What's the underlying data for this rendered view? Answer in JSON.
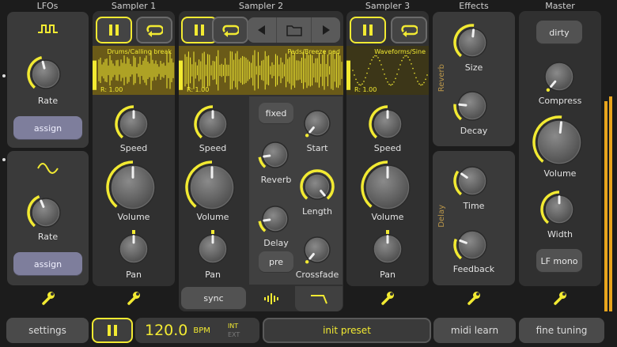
{
  "headers": {
    "lfos": "LFOs",
    "sampler1": "Sampler 1",
    "sampler2": "Sampler 2",
    "sampler3": "Sampler 3",
    "effects": "Effects",
    "master": "Master"
  },
  "lfo1": {
    "knob_label": "Rate",
    "assign_label": "assign",
    "icon": "square-wave-icon"
  },
  "lfo2": {
    "knob_label": "Rate",
    "assign_label": "assign",
    "icon": "sine-wave-icon"
  },
  "sampler1": {
    "sample": "Drums/Calling break",
    "rate": "R: 1.00",
    "speed": "Speed",
    "volume": "Volume",
    "pan": "Pan"
  },
  "sampler2": {
    "sample": "Pads/Breeze pad",
    "rate": "R: 1.00",
    "speed": "Speed",
    "volume": "Volume",
    "pan": "Pan",
    "sync_label": "sync"
  },
  "sampler_settings": {
    "fixed_label": "fixed",
    "pre_label": "pre",
    "reverb": "Reverb",
    "delay": "Delay",
    "start": "Start",
    "length": "Length",
    "crossfade": "Crossfade"
  },
  "sampler3": {
    "sample": "Waveforms/Sine",
    "rate": "R: 1.00",
    "speed": "Speed",
    "volume": "Volume",
    "pan": "Pan"
  },
  "effects": {
    "reverb_group": "Reverb",
    "delay_group": "Delay",
    "size": "Size",
    "decay": "Decay",
    "time": "Time",
    "feedback": "Feedback"
  },
  "master": {
    "dirty_label": "dirty",
    "compress": "Compress",
    "volume": "Volume",
    "width": "Width",
    "lf_mono_label": "LF mono"
  },
  "bottom": {
    "settings_label": "settings",
    "bpm_value": "120.0",
    "bpm_unit": "BPM",
    "int_label": "INT",
    "ext_label": "EXT",
    "preset_label": "init preset",
    "midi_learn_label": "midi learn",
    "fine_tuning_label": "fine tuning"
  },
  "colors": {
    "accent": "#f2ea32",
    "wave_bg": "#6a5a18",
    "assign": "#7e7e9c",
    "group_label": "#b8954a"
  }
}
